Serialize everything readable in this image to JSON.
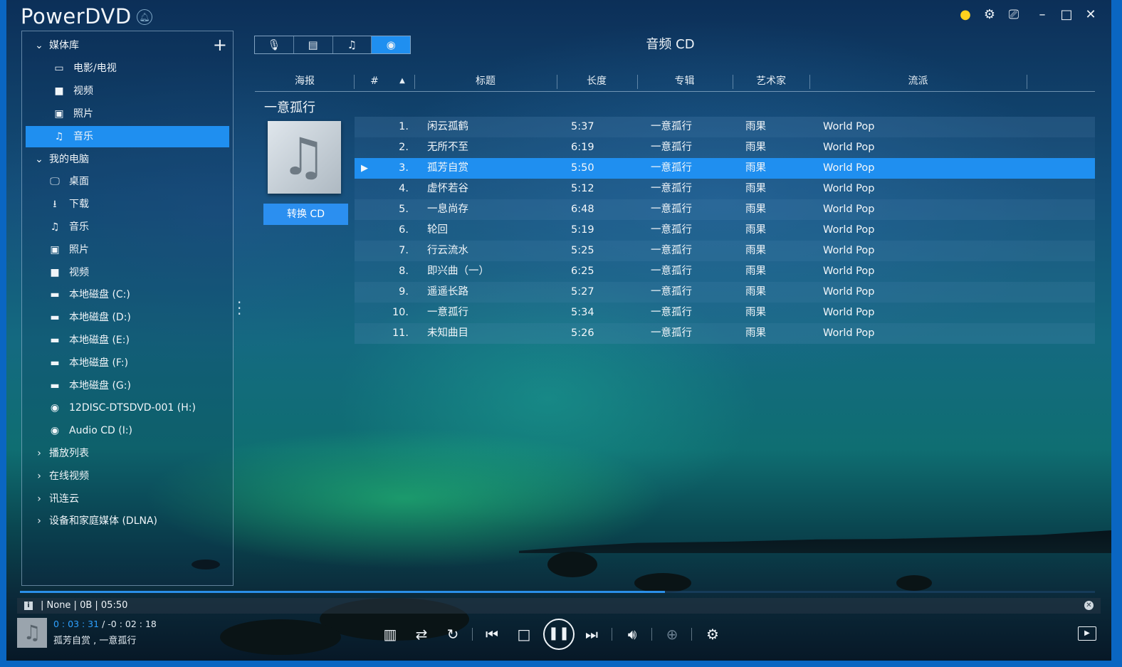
{
  "app": {
    "title": "PowerDVD"
  },
  "sidebar": {
    "items": [
      {
        "label": "媒体库",
        "icon": "chevron-down-icon",
        "level": 0
      },
      {
        "label": "电影/电视",
        "icon": "film-icon",
        "level": 1
      },
      {
        "label": "视频",
        "icon": "video-camera-icon",
        "level": 1
      },
      {
        "label": "照片",
        "icon": "photo-icon",
        "level": 1
      },
      {
        "label": "音乐",
        "icon": "music-note-icon",
        "level": 1,
        "selected": true
      },
      {
        "label": "我的电脑",
        "icon": "chevron-down-icon",
        "level": 0
      },
      {
        "label": "桌面",
        "icon": "monitor-icon",
        "level": 1
      },
      {
        "label": "下载",
        "icon": "download-icon",
        "level": 1
      },
      {
        "label": "音乐",
        "icon": "music-note-icon",
        "level": 1
      },
      {
        "label": "照片",
        "icon": "photo-icon",
        "level": 1
      },
      {
        "label": "视频",
        "icon": "video-camera-icon",
        "level": 1
      },
      {
        "label": "本地磁盘 (C:)",
        "icon": "drive-icon",
        "level": 1
      },
      {
        "label": "本地磁盘 (D:)",
        "icon": "drive-icon",
        "level": 1
      },
      {
        "label": "本地磁盘 (E:)",
        "icon": "drive-icon",
        "level": 1
      },
      {
        "label": "本地磁盘 (F:)",
        "icon": "drive-icon",
        "level": 1
      },
      {
        "label": "本地磁盘 (G:)",
        "icon": "drive-icon",
        "level": 1
      },
      {
        "label": "12DISC-DTSDVD-001 (H:)",
        "icon": "disc-icon",
        "level": 1
      },
      {
        "label": "Audio CD (I:)",
        "icon": "disc-icon",
        "level": 1
      },
      {
        "label": "播放列表",
        "icon": "chevron-right-icon",
        "level": 0
      },
      {
        "label": "在线视频",
        "icon": "chevron-right-icon",
        "level": 0
      },
      {
        "label": "讯连云",
        "icon": "chevron-right-icon",
        "level": 0
      },
      {
        "label": "设备和家庭媒体 (DLNA)",
        "icon": "chevron-right-icon",
        "level": 0
      }
    ]
  },
  "tabs": [
    {
      "icon": "microphone-icon"
    },
    {
      "icon": "album-list-icon"
    },
    {
      "icon": "music-note-icon"
    },
    {
      "icon": "cd-icon",
      "active": true
    }
  ],
  "view_title": "音频 CD",
  "columns": {
    "poster": "海报",
    "num": "#",
    "title": "标题",
    "length": "长度",
    "album": "专辑",
    "artist": "艺术家",
    "genre": "流派"
  },
  "album": {
    "name": "一意孤行",
    "convert_label": "转换 CD"
  },
  "tracks": [
    {
      "num": "1.",
      "title": "闲云孤鹤",
      "length": "5:37",
      "album": "一意孤行",
      "artist": "雨果",
      "genre": "World Pop"
    },
    {
      "num": "2.",
      "title": "无所不至",
      "length": "6:19",
      "album": "一意孤行",
      "artist": "雨果",
      "genre": "World Pop"
    },
    {
      "num": "3.",
      "title": "孤芳自赏",
      "length": "5:50",
      "album": "一意孤行",
      "artist": "雨果",
      "genre": "World Pop",
      "playing": true
    },
    {
      "num": "4.",
      "title": "虚怀若谷",
      "length": "5:12",
      "album": "一意孤行",
      "artist": "雨果",
      "genre": "World Pop"
    },
    {
      "num": "5.",
      "title": "一息尚存",
      "length": "6:48",
      "album": "一意孤行",
      "artist": "雨果",
      "genre": "World Pop"
    },
    {
      "num": "6.",
      "title": "轮回",
      "length": "5:19",
      "album": "一意孤行",
      "artist": "雨果",
      "genre": "World Pop"
    },
    {
      "num": "7.",
      "title": "行云流水",
      "length": "5:25",
      "album": "一意孤行",
      "artist": "雨果",
      "genre": "World Pop"
    },
    {
      "num": "8.",
      "title": "即兴曲（一）",
      "length": "6:25",
      "album": "一意孤行",
      "artist": "雨果",
      "genre": "World Pop"
    },
    {
      "num": "9.",
      "title": "遥遥长路",
      "length": "5:27",
      "album": "一意孤行",
      "artist": "雨果",
      "genre": "World Pop"
    },
    {
      "num": "10.",
      "title": "一意孤行",
      "length": "5:34",
      "album": "一意孤行",
      "artist": "雨果",
      "genre": "World Pop"
    },
    {
      "num": "11.",
      "title": "未知曲目",
      "length": "5:26",
      "album": "一意孤行",
      "artist": "雨果",
      "genre": "World Pop"
    }
  ],
  "player": {
    "info": "| None | 0B | 05:50",
    "current_time": "0 : 03 : 31",
    "remaining_time": "/ -0 : 02 : 18",
    "now_playing": "孤芳自赏 , 一意孤行",
    "progress": 0.6
  },
  "colors": {
    "accent": "#1f8ff0",
    "time_current": "#2ea0ff"
  }
}
